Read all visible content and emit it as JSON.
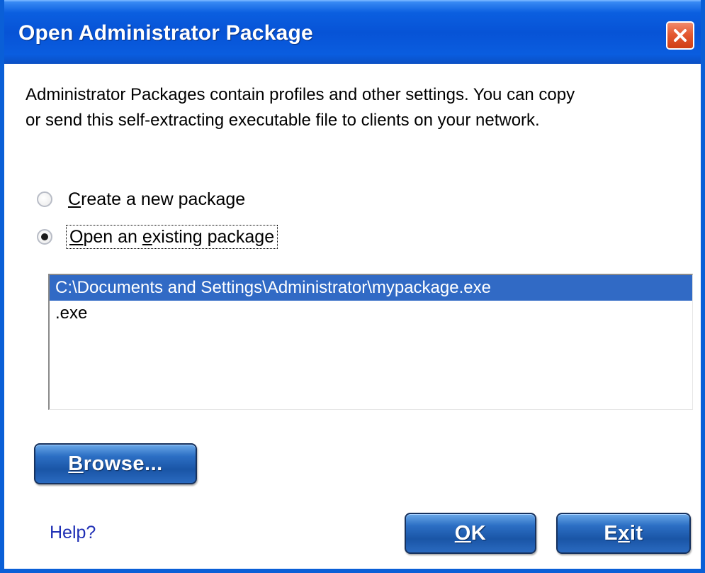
{
  "window": {
    "title": "Open Administrator Package",
    "close_icon": "close-icon",
    "colors": {
      "titlebar": "#0753d6",
      "close_button": "#e45a32",
      "selection": "#316ac5",
      "button": "#1a55a6",
      "help_link": "#1f2fb5"
    }
  },
  "description": {
    "line1": "Administrator Packages contain profiles and other settings. You can copy",
    "line2": "or send this self-extracting executable file to clients on your network."
  },
  "options": {
    "create_new": {
      "prefix": "",
      "mnemonic": "C",
      "rest": "reate a new package",
      "selected": false
    },
    "open_existing": {
      "prefix": "",
      "mnemonic": "O",
      "rest": "pen an ",
      "mnemonic2": "e",
      "rest2": "xisting package",
      "selected": true
    }
  },
  "package_list": {
    "items": [
      {
        "text": "C:\\Documents and Settings\\Administrator\\mypackage.exe",
        "selected": true
      },
      {
        "text": ".exe",
        "selected": false
      }
    ]
  },
  "buttons": {
    "browse": {
      "mnemonic": "B",
      "rest": "rowse..."
    },
    "ok": {
      "mnemonic": "O",
      "rest": "K"
    },
    "exit": {
      "pre": "E",
      "mnemonic": "x",
      "rest": "it"
    }
  },
  "help": {
    "label": "Help?"
  }
}
